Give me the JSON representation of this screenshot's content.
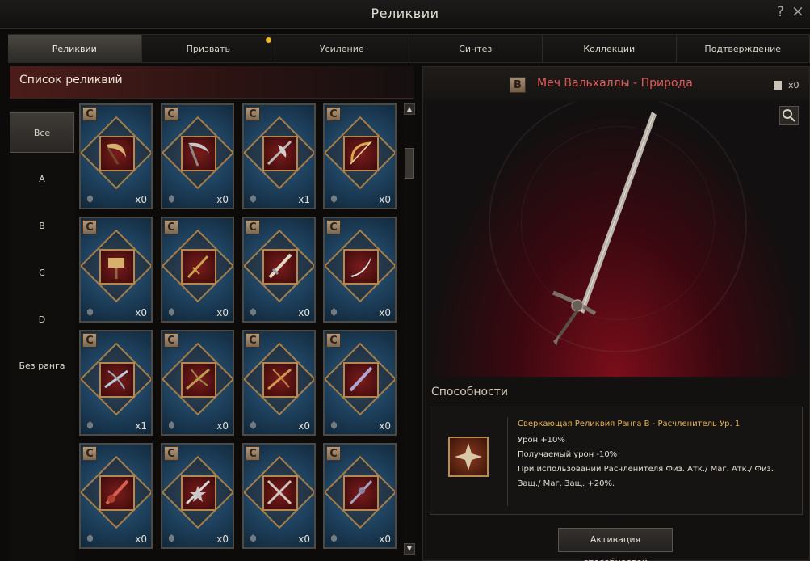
{
  "window": {
    "title": "Реликвии",
    "help_label": "?",
    "close_label": "×"
  },
  "tabs": [
    {
      "label": "Реликвии"
    },
    {
      "label": "Призвать"
    },
    {
      "label": "Усиление"
    },
    {
      "label": "Синтез"
    },
    {
      "label": "Коллекции"
    },
    {
      "label": "Подтверждение"
    }
  ],
  "list_header": {
    "title": "Список реликвий"
  },
  "ranks": [
    "Все",
    "A",
    "B",
    "C",
    "D",
    "Без ранга"
  ],
  "relics": [
    {
      "rank": "C",
      "count": "x0"
    },
    {
      "rank": "C",
      "count": "x0"
    },
    {
      "rank": "C",
      "count": "x1"
    },
    {
      "rank": "C",
      "count": "x0"
    },
    {
      "rank": "C",
      "count": "x0"
    },
    {
      "rank": "C",
      "count": "x0"
    },
    {
      "rank": "C",
      "count": "x0"
    },
    {
      "rank": "C",
      "count": "x0"
    },
    {
      "rank": "C",
      "count": "x1"
    },
    {
      "rank": "C",
      "count": "x0"
    },
    {
      "rank": "C",
      "count": "x0"
    },
    {
      "rank": "C",
      "count": "x0"
    },
    {
      "rank": "C",
      "count": "x0"
    },
    {
      "rank": "C",
      "count": "x0"
    },
    {
      "rank": "C",
      "count": "x0"
    },
    {
      "rank": "C",
      "count": "x0"
    }
  ],
  "detail": {
    "rank": "B",
    "name": "Меч Вальхаллы - Природа",
    "quantity": "x0",
    "abilities_title": "Способности",
    "ability": {
      "name": "Сверкающая Реликвия Ранга B - Расчленитель Ур. 1",
      "lines": [
        "Урон +10%",
        "Получаемый урон -10%",
        "При использовании Расчленителя Физ. Атк./ Маг. Атк./ Физ. Защ./ Маг. Защ. +20%."
      ]
    },
    "activate_label": "Активация способностей"
  },
  "colors": {
    "accent_red": "#e45a5a",
    "ability_gold": "#e8b24a",
    "tab_dot": "#f2b81f"
  }
}
